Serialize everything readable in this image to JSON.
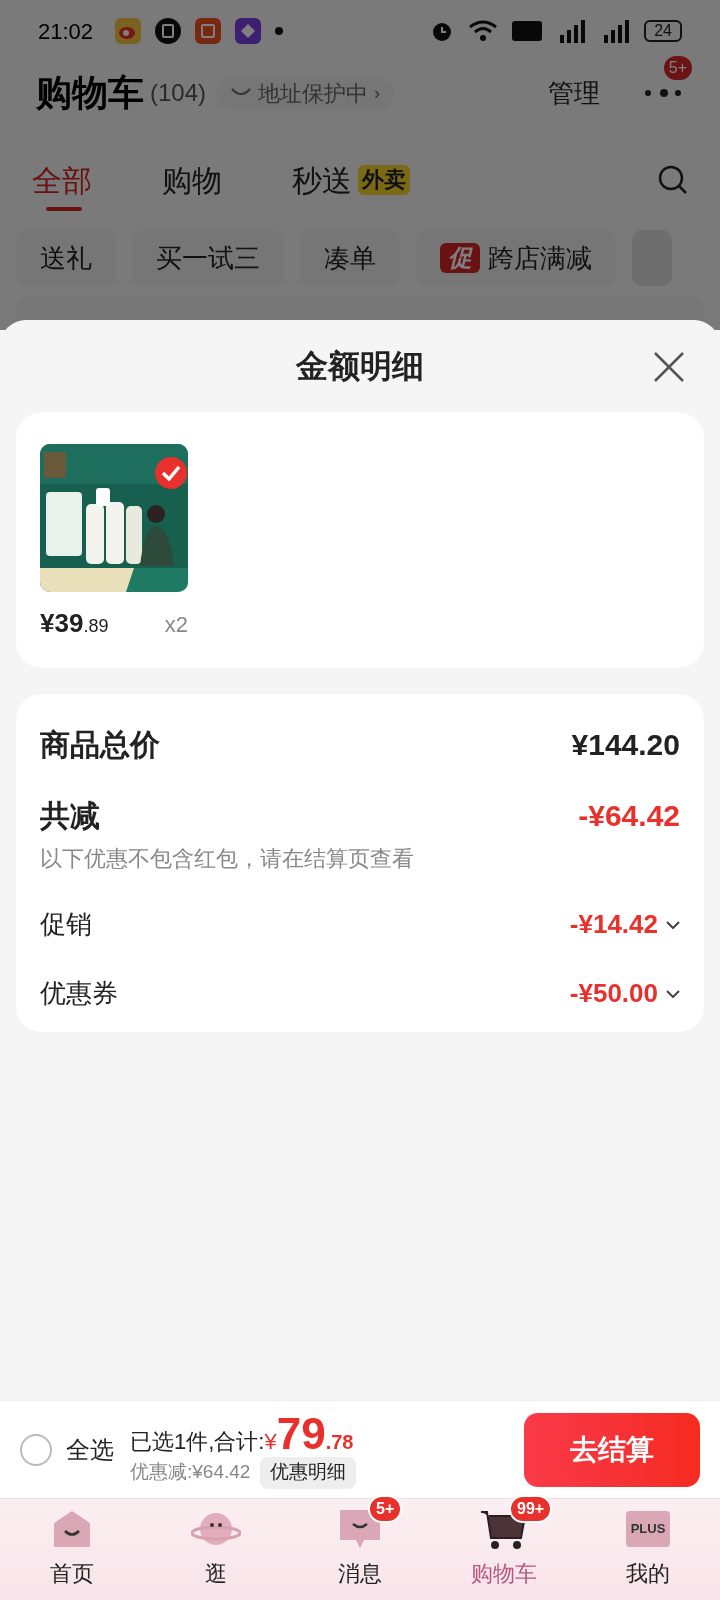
{
  "status_bar": {
    "time": "21:02",
    "battery": "24"
  },
  "header": {
    "title": "购物车",
    "count": "(104)",
    "address": "地址保护中",
    "address_arrow": "›",
    "manage": "管理",
    "more_badge": "5+"
  },
  "tabs": [
    {
      "label": "全部",
      "selected": true
    },
    {
      "label": "购物",
      "selected": false
    },
    {
      "label": "秒送",
      "badge": "外卖",
      "selected": false
    }
  ],
  "chips": [
    {
      "label": "送礼"
    },
    {
      "label": "买一试三"
    },
    {
      "label": "凑单"
    },
    {
      "label": "跨店满减",
      "tag": "促"
    }
  ],
  "sheet": {
    "title": "金额明细",
    "items": [
      {
        "kind": "picture",
        "selected": true,
        "currency": "¥",
        "price_int": "39",
        "price_dec": ".89",
        "qty": "x2"
      }
    ],
    "summary": {
      "total_label": "商品总价",
      "total": "¥144.20",
      "reduce_label": "共减",
      "reduce": "-¥64.42",
      "note": "以下优惠不包含红包，请在结算页查看",
      "lines": [
        {
          "label": "促销",
          "amount": "-¥14.42"
        },
        {
          "label": "优惠券",
          "amount": "-¥50.00"
        }
      ]
    }
  },
  "bottom_bar": {
    "select_all": "全选",
    "checked": false,
    "summary": "已选1件,合计:",
    "currency": "¥",
    "total_int": "79",
    "total_dec": ".78",
    "discount": "优惠减:¥64.42",
    "detail_button": "优惠明细",
    "checkout": "去结算"
  },
  "nav": [
    {
      "label": "首页",
      "kind": "home",
      "selected": false
    },
    {
      "label": "逛",
      "kind": "planet",
      "selected": false
    },
    {
      "label": "消息",
      "kind": "message",
      "badge": "5+",
      "selected": false
    },
    {
      "label": "购物车",
      "kind": "cart",
      "badge": "99+",
      "selected": true
    },
    {
      "label": "我的",
      "kind": "plus",
      "icon_text": "PLUS",
      "selected": false
    }
  ]
}
